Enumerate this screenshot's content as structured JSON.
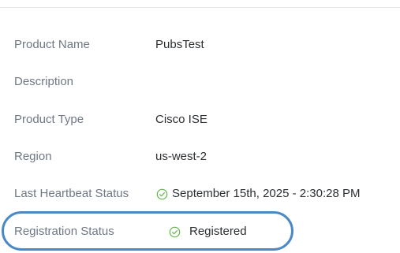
{
  "details": {
    "product_name": {
      "label": "Product Name",
      "value": "PubsTest"
    },
    "description": {
      "label": "Description",
      "value": ""
    },
    "product_type": {
      "label": "Product Type",
      "value": "Cisco ISE"
    },
    "region": {
      "label": "Region",
      "value": "us-west-2"
    },
    "last_heartbeat": {
      "label": "Last Heartbeat Status",
      "value": "September 15th, 2025 - 2:30:28 PM",
      "icon": "check-circle-icon"
    },
    "registration": {
      "label": "Registration Status",
      "value": "Registered",
      "icon": "check-circle-icon"
    }
  },
  "colors": {
    "label": "#6f7885",
    "value": "#2b2f33",
    "success": "#5fb84a",
    "highlight": "#4a89c5",
    "divider": "#e3e6ea"
  }
}
